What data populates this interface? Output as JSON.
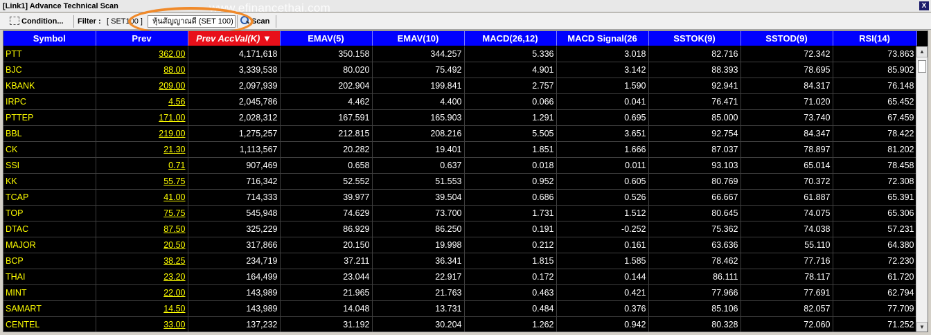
{
  "window": {
    "title": "[Link1] Advance Technical Scan",
    "close_label": "X"
  },
  "toolbar": {
    "condition_label": "Condition...",
    "filter_label": "Filter :",
    "filter_value": "[ SET100 ]",
    "filter_select": "หุ้นสัญญาณดี (SET 100)",
    "scan_label": "Scan"
  },
  "watermark": "www.efinancethai.com",
  "columns": [
    "Symbol",
    "Prev",
    "Prev AccVal(K) ▼",
    "EMAV(5)",
    "EMAV(10)",
    "MACD(26,12)",
    "MACD Signal(26",
    "SSTOK(9)",
    "SSTOD(9)",
    "RSI(14)"
  ],
  "rows": [
    [
      "PTT",
      "362.00",
      "4,171,618",
      "350.158",
      "344.257",
      "5.336",
      "3.018",
      "82.716",
      "72.342",
      "73.863"
    ],
    [
      "BJC",
      "88.00",
      "3,339,538",
      "80.020",
      "75.492",
      "4.901",
      "3.142",
      "88.393",
      "78.695",
      "85.902"
    ],
    [
      "KBANK",
      "209.00",
      "2,097,939",
      "202.904",
      "199.841",
      "2.757",
      "1.590",
      "92.941",
      "84.317",
      "76.148"
    ],
    [
      "IRPC",
      "4.56",
      "2,045,786",
      "4.462",
      "4.400",
      "0.066",
      "0.041",
      "76.471",
      "71.020",
      "65.452"
    ],
    [
      "PTTEP",
      "171.00",
      "2,028,312",
      "167.591",
      "165.903",
      "1.291",
      "0.695",
      "85.000",
      "73.740",
      "67.459"
    ],
    [
      "BBL",
      "219.00",
      "1,275,257",
      "212.815",
      "208.216",
      "5.505",
      "3.651",
      "92.754",
      "84.347",
      "78.422"
    ],
    [
      "CK",
      "21.30",
      "1,113,567",
      "20.282",
      "19.401",
      "1.851",
      "1.666",
      "87.037",
      "78.897",
      "81.202"
    ],
    [
      "SSI",
      "0.71",
      "907,469",
      "0.658",
      "0.637",
      "0.018",
      "0.011",
      "93.103",
      "65.014",
      "78.458"
    ],
    [
      "KK",
      "55.75",
      "716,342",
      "52.552",
      "51.553",
      "0.952",
      "0.605",
      "80.769",
      "70.372",
      "72.308"
    ],
    [
      "TCAP",
      "41.00",
      "714,333",
      "39.977",
      "39.504",
      "0.686",
      "0.526",
      "66.667",
      "61.887",
      "65.391"
    ],
    [
      "TOP",
      "75.75",
      "545,948",
      "74.629",
      "73.700",
      "1.731",
      "1.512",
      "80.645",
      "74.075",
      "65.306"
    ],
    [
      "DTAC",
      "87.50",
      "325,229",
      "86.929",
      "86.250",
      "0.191",
      "-0.252",
      "75.362",
      "74.038",
      "57.231"
    ],
    [
      "MAJOR",
      "20.50",
      "317,866",
      "20.150",
      "19.998",
      "0.212",
      "0.161",
      "63.636",
      "55.110",
      "64.380"
    ],
    [
      "BCP",
      "38.25",
      "234,719",
      "37.211",
      "36.341",
      "1.815",
      "1.585",
      "78.462",
      "77.716",
      "72.230"
    ],
    [
      "THAI",
      "23.20",
      "164,499",
      "23.044",
      "22.917",
      "0.172",
      "0.144",
      "86.111",
      "78.117",
      "61.720"
    ],
    [
      "MINT",
      "22.00",
      "143,989",
      "21.965",
      "21.763",
      "0.463",
      "0.421",
      "77.966",
      "77.691",
      "62.794"
    ],
    [
      "SAMART",
      "14.50",
      "143,989",
      "14.048",
      "13.731",
      "0.484",
      "0.376",
      "85.106",
      "82.057",
      "77.709"
    ],
    [
      "CENTEL",
      "33.00",
      "137,232",
      "31.192",
      "30.204",
      "1.262",
      "0.942",
      "80.328",
      "72.060",
      "71.252"
    ]
  ],
  "colors": {
    "header": "#0000ff",
    "sorted_header": "#e8101a",
    "symbol_text": "#ffff00",
    "grid_bg": "#000000",
    "highlight_ring": "#f08a2a"
  }
}
